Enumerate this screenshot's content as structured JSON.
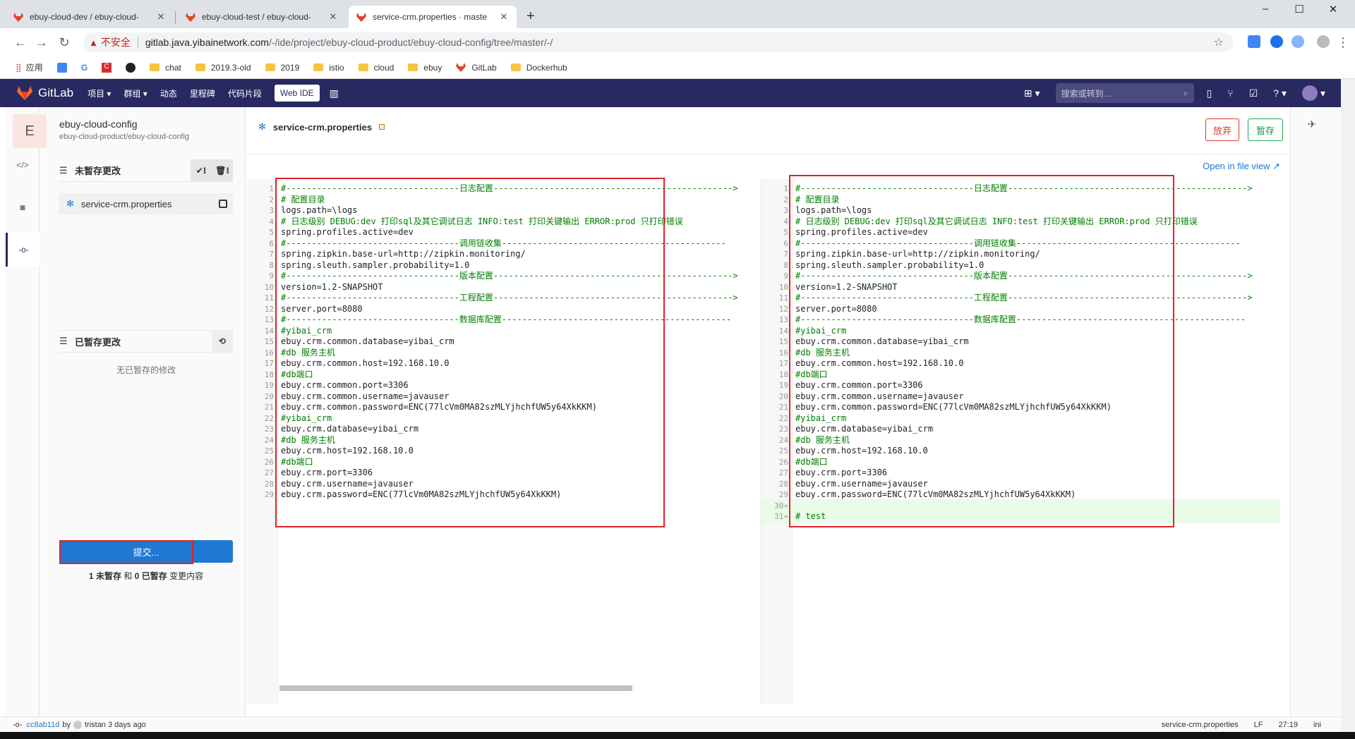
{
  "browser": {
    "tabs": [
      {
        "title": "ebuy-cloud-dev / ebuy-cloud-",
        "active": false
      },
      {
        "title": "ebuy-cloud-test / ebuy-cloud-",
        "active": false
      },
      {
        "title": "service-crm.properties · maste",
        "active": true
      }
    ],
    "new_tab": "+",
    "window_controls": [
      "–",
      "☐",
      "✕"
    ],
    "insecure_label": "不安全",
    "url_host": "gitlab.java.yibainetwork.com",
    "url_path": "/-/ide/project/ebuy-cloud-product/ebuy-cloud-config/tree/master/-/",
    "bookmarks": [
      "应用",
      "chat",
      "2019.3-old",
      "2019",
      "istio",
      "cloud",
      "ebuy",
      "GitLab",
      "Dockerhub"
    ]
  },
  "gitlab_header": {
    "brand": "GitLab",
    "nav": [
      "项目 ▾",
      "群组 ▾",
      "动态",
      "里程碑",
      "代码片段"
    ],
    "web_ide": "Web IDE",
    "search_placeholder": "搜索或转到…",
    "bg_color": "#292961"
  },
  "sidebar": {
    "avatar_letter": "E",
    "project_name": "ebuy-cloud-config",
    "project_path": "ebuy-cloud-product/ebuy-cloud-config",
    "unstaged_title": "未暂存更改",
    "unstaged_files": [
      "service-crm.properties"
    ],
    "staged_title": "已暂存更改",
    "staged_empty": "无已暂存的修改",
    "commit_button": "提交...",
    "commit_summary": {
      "unstaged_count": "1",
      "unstaged": "未暂存",
      "and": "和",
      "staged_count": "0",
      "staged": "已暂存",
      "suffix": "变更内容"
    }
  },
  "editor": {
    "file_name": "service-crm.properties",
    "discard": "放弃",
    "stage": "暂存",
    "open_in_file_view": "Open in file view ↗",
    "left_lines": [
      "#----------------------------------日志配置----------------------------------------------->",
      "# 配置目录",
      "logs.path=\\logs",
      "# 日志级别 DEBUG:dev 打印sql及其它调试日志 INFO:test 打印关键输出 ERROR:prod 只打印错误",
      "spring.profiles.active=dev",
      "#----------------------------------调用链收集--------------------------------------------",
      "spring.zipkin.base-url=http://zipkin.monitoring/",
      "spring.sleuth.sampler.probability=1.0",
      "#----------------------------------版本配置----------------------------------------------->",
      "version=1.2-SNAPSHOT",
      "#----------------------------------工程配置----------------------------------------------->",
      "server.port=8080",
      "#----------------------------------数据库配置---------------------------------------------",
      "#yibai_crm",
      "ebuy.crm.common.database=yibai_crm",
      "#db 服务主机",
      "ebuy.crm.common.host=192.168.10.0",
      "#db端口",
      "ebuy.crm.common.port=3306",
      "ebuy.crm.common.username=javauser",
      "ebuy.crm.common.password=ENC(77lcVm0MA82szMLYjhchfUW5y64XkKKM)",
      "#yibai_crm",
      "ebuy.crm.database=yibai_crm",
      "#db 服务主机",
      "ebuy.crm.host=192.168.10.0",
      "#db端口",
      "ebuy.crm.port=3306",
      "ebuy.crm.username=javauser",
      "ebuy.crm.password=ENC(77lcVm0MA82szMLYjhchfUW5y64XkKKM)"
    ],
    "right_extra_lines": [
      "",
      "# test"
    ]
  },
  "status_bar": {
    "commit": "cc8ab11d",
    "by": "by",
    "author": "tristan 3 days ago",
    "file": "service-crm.properties",
    "eol": "LF",
    "position": "27:19",
    "lang": "ini"
  }
}
